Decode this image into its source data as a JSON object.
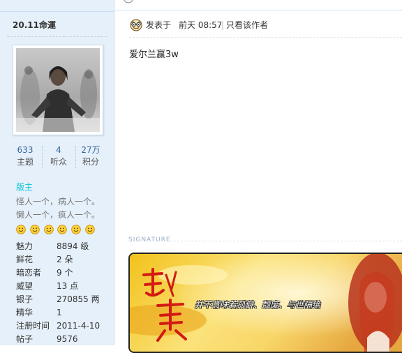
{
  "profile": {
    "username": "20.11命運",
    "stats": [
      {
        "value": "633",
        "label": "主题"
      },
      {
        "value": "4",
        "label": "听众"
      },
      {
        "value": "27万",
        "label": "积分"
      }
    ],
    "rank": "版主",
    "motto_lines": [
      "怪人一个，病人一个。",
      "懒人一个，疯人一个。"
    ],
    "info": [
      {
        "key": "魅力",
        "value": "8894 级"
      },
      {
        "key": "鲜花",
        "value": "2 朵"
      },
      {
        "key": "暗恋者",
        "value": "9 个"
      },
      {
        "key": "威望",
        "value": "13 点"
      },
      {
        "key": "银子",
        "value": "270855 两"
      },
      {
        "key": "精华",
        "value": "1"
      },
      {
        "key": "注册时间",
        "value": "2011-4-10"
      },
      {
        "key": "帖子",
        "value": "9576"
      }
    ]
  },
  "post": {
    "posted_label": "发表于",
    "time": "前天 08:57",
    "separator": "|",
    "only_author": "只看该作者",
    "message": "爱尔兰赢3w"
  },
  "signature": {
    "label": "SIGNATURE",
    "caption": "并不意味着孤僻、颓废、与世隔绝"
  },
  "colors": {
    "sidebar_bg": "#e6f0fa",
    "stat_number": "#336699",
    "rank": "#00c4d4"
  }
}
